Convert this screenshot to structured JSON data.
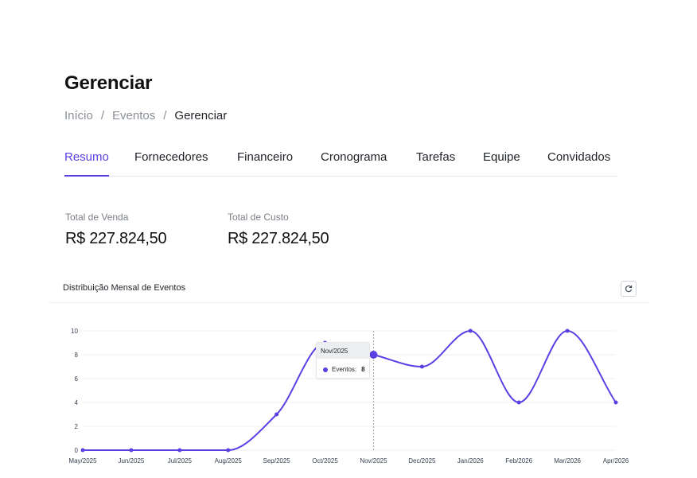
{
  "page": {
    "title": "Gerenciar"
  },
  "breadcrumb": {
    "items": [
      "Início",
      "Eventos",
      "Gerenciar"
    ],
    "separator": "/"
  },
  "tabs": [
    {
      "label": "Resumo",
      "active": true
    },
    {
      "label": "Fornecedores",
      "active": false
    },
    {
      "label": "Financeiro",
      "active": false
    },
    {
      "label": "Cronograma",
      "active": false
    },
    {
      "label": "Tarefas",
      "active": false
    },
    {
      "label": "Equipe",
      "active": false
    },
    {
      "label": "Convidados",
      "active": false
    }
  ],
  "stats": {
    "total_venda": {
      "label": "Total de Venda",
      "value": "R$ 227.824,50"
    },
    "total_custo": {
      "label": "Total de Custo",
      "value": "R$ 227.824,50"
    }
  },
  "chart_section": {
    "title": "Distribuição Mensal de Eventos",
    "refresh_icon": "refresh-icon"
  },
  "colors": {
    "accent": "#5b3fe3",
    "grid": "#eef0f2",
    "text": "#1f2328"
  },
  "tooltip": {
    "header": "Nov/2025",
    "series_label": "Eventos:",
    "value": "8"
  },
  "chart_data": {
    "type": "line",
    "categories": [
      "May/2025",
      "Jun/2025",
      "Jul/2025",
      "Aug/2025",
      "Sep/2025",
      "Oct/2025",
      "Nov/2025",
      "Dec/2025",
      "Jan/2026",
      "Feb/2026",
      "Mar/2026",
      "Apr/2026"
    ],
    "series": [
      {
        "name": "Eventos",
        "values": [
          0,
          0,
          0,
          0,
          3,
          9,
          8,
          7,
          10,
          4,
          10,
          4
        ]
      }
    ],
    "y_ticks": [
      0,
      2,
      4,
      6,
      8,
      10
    ],
    "ylim": [
      0,
      10
    ],
    "grid": true,
    "smooth": true,
    "highlight_index": 6
  }
}
